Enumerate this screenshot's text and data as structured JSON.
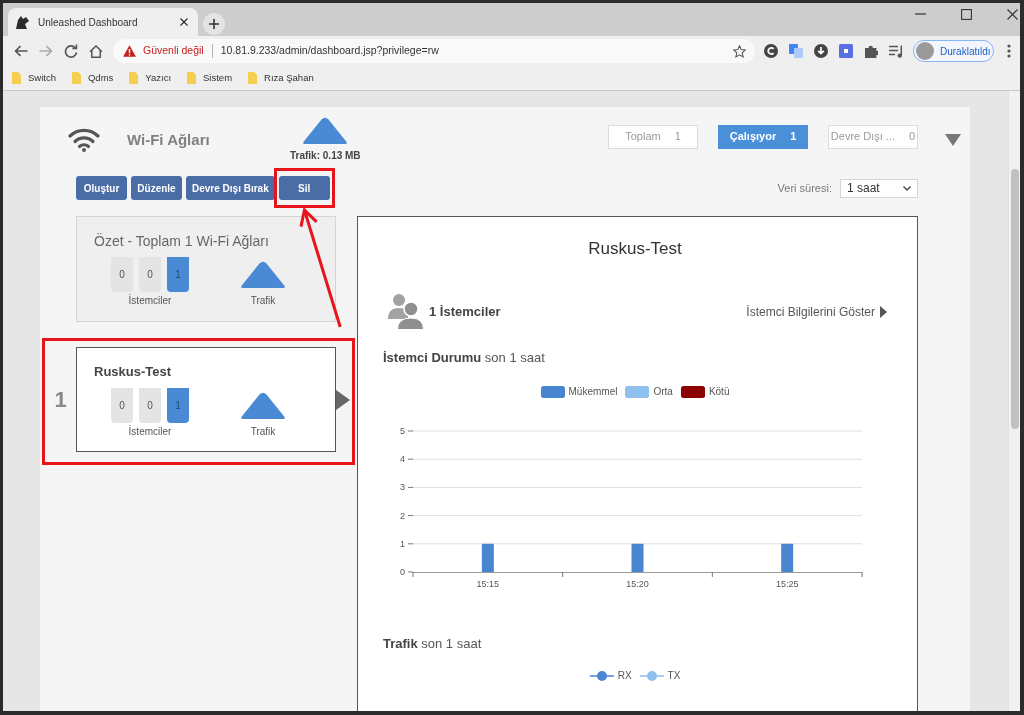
{
  "browser": {
    "tab_title": "Unleashed Dashboard",
    "security_label": "Güvenli değil",
    "url": "10.81.9.233/admin/dashboard.jsp?privilege=rw",
    "profile_label": "Duraklatıldı",
    "bookmarks": [
      "Switch",
      "Qdms",
      "Yazıcı",
      "Sistem",
      "Rıza Şahan"
    ]
  },
  "header": {
    "title": "Wi-Fi Ağları",
    "traffic": "Trafik: 0.13 MB"
  },
  "filters": [
    {
      "label": "Toplam",
      "count": "1",
      "selected": false
    },
    {
      "label": "Çalışıyor",
      "count": "1",
      "selected": true
    },
    {
      "label": "Devre Dışı ...",
      "count": "0",
      "selected": false
    }
  ],
  "actions": [
    {
      "label": "Oluştur",
      "highlighted": false
    },
    {
      "label": "Düzenle",
      "highlighted": false
    },
    {
      "label": "Devre Dışı Bırak",
      "highlighted": false
    },
    {
      "label": "Sil",
      "highlighted": true
    }
  ],
  "data_period": {
    "label": "Veri süresi:",
    "value": "1 saat"
  },
  "summary": {
    "title": "Özet - Toplam 1 Wi-Fi Ağları",
    "clients": [
      {
        "value": "0",
        "color": "#e4e4e4"
      },
      {
        "value": "0",
        "color": "#e4e4e4"
      },
      {
        "value": "1",
        "color": "#4a8ad4"
      }
    ],
    "clients_label": "İstemciler",
    "traffic_label": "Trafik"
  },
  "networks": [
    {
      "index": "1",
      "name": "Ruskus-Test",
      "selected": true,
      "highlighted": true,
      "clients": [
        {
          "value": "0",
          "color": "#e4e4e4"
        },
        {
          "value": "0",
          "color": "#e4e4e4"
        },
        {
          "value": "1",
          "color": "#4a8ad4"
        }
      ],
      "clients_label": "İstemciler",
      "traffic_label": "Trafik"
    }
  ],
  "callout_arrow": true,
  "detail": {
    "title": "Ruskus-Test",
    "client_count": "1 İstemciler",
    "client_link": "İstemci Bilgilerini Göster",
    "status_title": "**İstemci Durumu** son 1 saat",
    "chart_data": {
      "type": "bar",
      "categories": [
        "15:15",
        "15:20",
        "15:25"
      ],
      "series": [
        {
          "name": "Mükemmel",
          "color": "#4a86d0",
          "values": [
            1,
            1,
            1
          ]
        },
        {
          "name": "Orta",
          "color": "#8fc1ef",
          "values": [
            0,
            0,
            0
          ]
        },
        {
          "name": "Kötü",
          "color": "#8b0000",
          "values": [
            0,
            0,
            0
          ]
        }
      ],
      "ylim": [
        0,
        5
      ],
      "yticks": [
        0,
        1,
        2,
        3,
        4,
        5
      ],
      "stacked": true,
      "grid": true
    },
    "traffic_title": "**Trafik** son 1 saat",
    "traffic_legend": [
      {
        "name": "RX",
        "color": "#4a86d0"
      },
      {
        "name": "TX",
        "color": "#8fc1ef"
      }
    ]
  }
}
